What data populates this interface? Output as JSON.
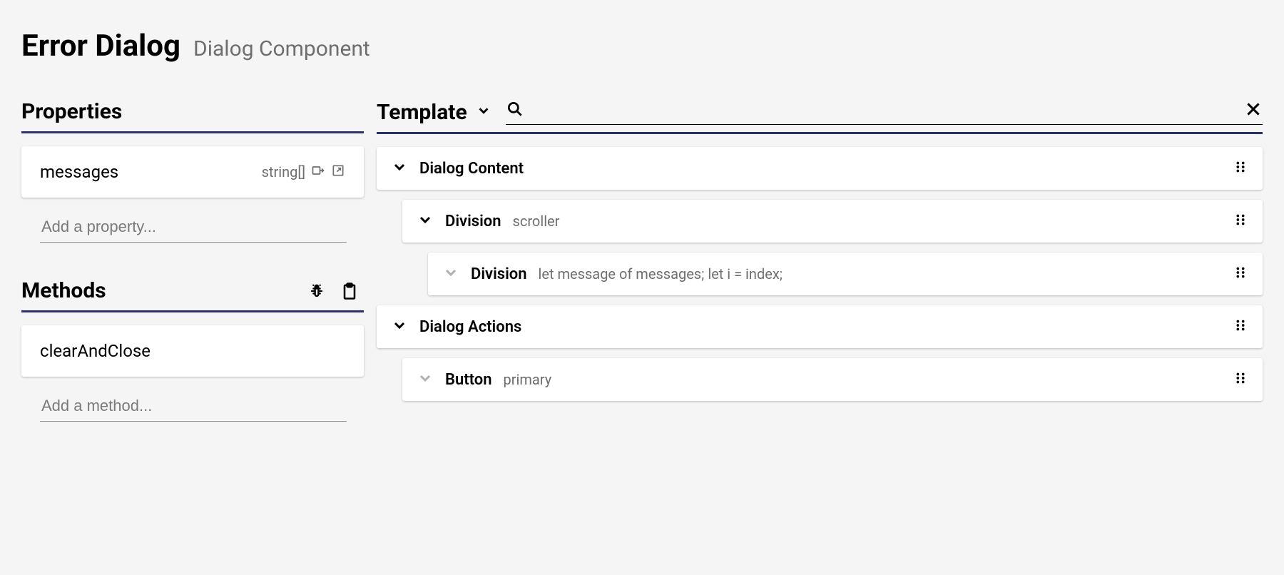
{
  "page": {
    "title": "Error Dialog",
    "subtitle": "Dialog Component"
  },
  "sections": {
    "properties": "Properties",
    "methods": "Methods",
    "template": "Template"
  },
  "properties": {
    "items": [
      {
        "name": "messages",
        "type": "string[]"
      }
    ],
    "add_placeholder": "Add a property..."
  },
  "methods": {
    "items": [
      {
        "name": "clearAndClose"
      }
    ],
    "add_placeholder": "Add a method..."
  },
  "template": {
    "search_placeholder": "",
    "tree": [
      {
        "label": "Dialog Content",
        "sub": "",
        "indent": 0,
        "expanded": true
      },
      {
        "label": "Division",
        "sub": "scroller",
        "indent": 1,
        "expanded": true
      },
      {
        "label": "Division",
        "sub": "let message of messages; let i = index;",
        "indent": 2,
        "expanded": false
      },
      {
        "label": "Dialog Actions",
        "sub": "",
        "indent": 0,
        "expanded": true
      },
      {
        "label": "Button",
        "sub": "primary",
        "indent": 1,
        "expanded": false
      }
    ]
  }
}
